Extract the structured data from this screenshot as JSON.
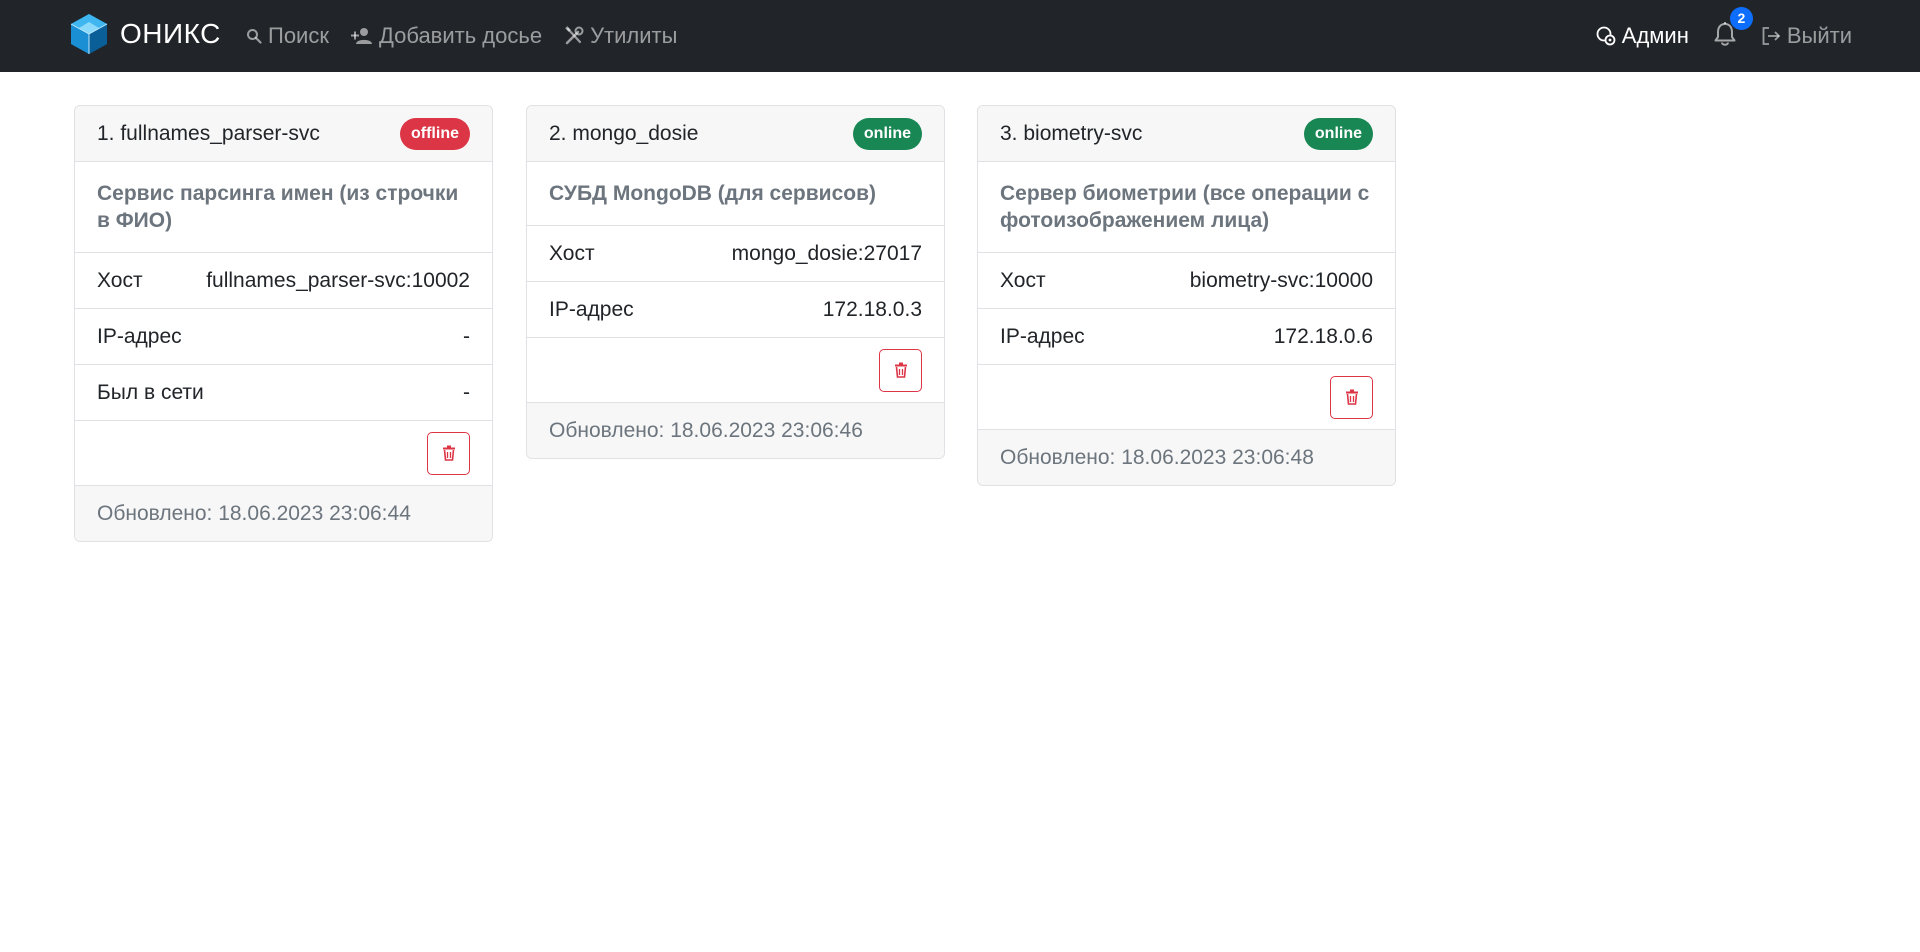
{
  "navbar": {
    "brand": "ОНИКС",
    "links": [
      {
        "label": "Поиск",
        "icon": "search-icon"
      },
      {
        "label": "Добавить досье",
        "icon": "person-add-icon"
      },
      {
        "label": "Утилиты",
        "icon": "tools-icon"
      }
    ],
    "admin_label": "Админ",
    "notification_count": "2",
    "logout_label": "Выйти"
  },
  "labels": {
    "host": "Хост",
    "ip": "IP-адрес",
    "last_seen": "Был в сети",
    "updated_prefix": "Обновлено: "
  },
  "services": [
    {
      "title": "1. fullnames_parser-svc",
      "status": "offline",
      "status_color": "#dc3545",
      "description": "Сервис парсинга имен (из строчки в ФИО)",
      "host": "fullnames_parser-svc:10002",
      "ip": "-",
      "last_seen": "-",
      "updated": "Обновлено: 18.06.2023 23:06:44"
    },
    {
      "title": "2. mongo_dosie",
      "status": "online",
      "status_color": "#198754",
      "description": "СУБД MongoDB (для сервисов)",
      "host": "mongo_dosie:27017",
      "ip": "172.18.0.3",
      "updated": "Обновлено: 18.06.2023 23:06:46"
    },
    {
      "title": "3. biometry-svc",
      "status": "online",
      "status_color": "#198754",
      "description": "Сервер биометрии (все операции с фотоизображением лица)",
      "host": "biometry-svc:10000",
      "ip": "172.18.0.6",
      "updated": "Обновлено: 18.06.2023 23:06:48"
    }
  ]
}
